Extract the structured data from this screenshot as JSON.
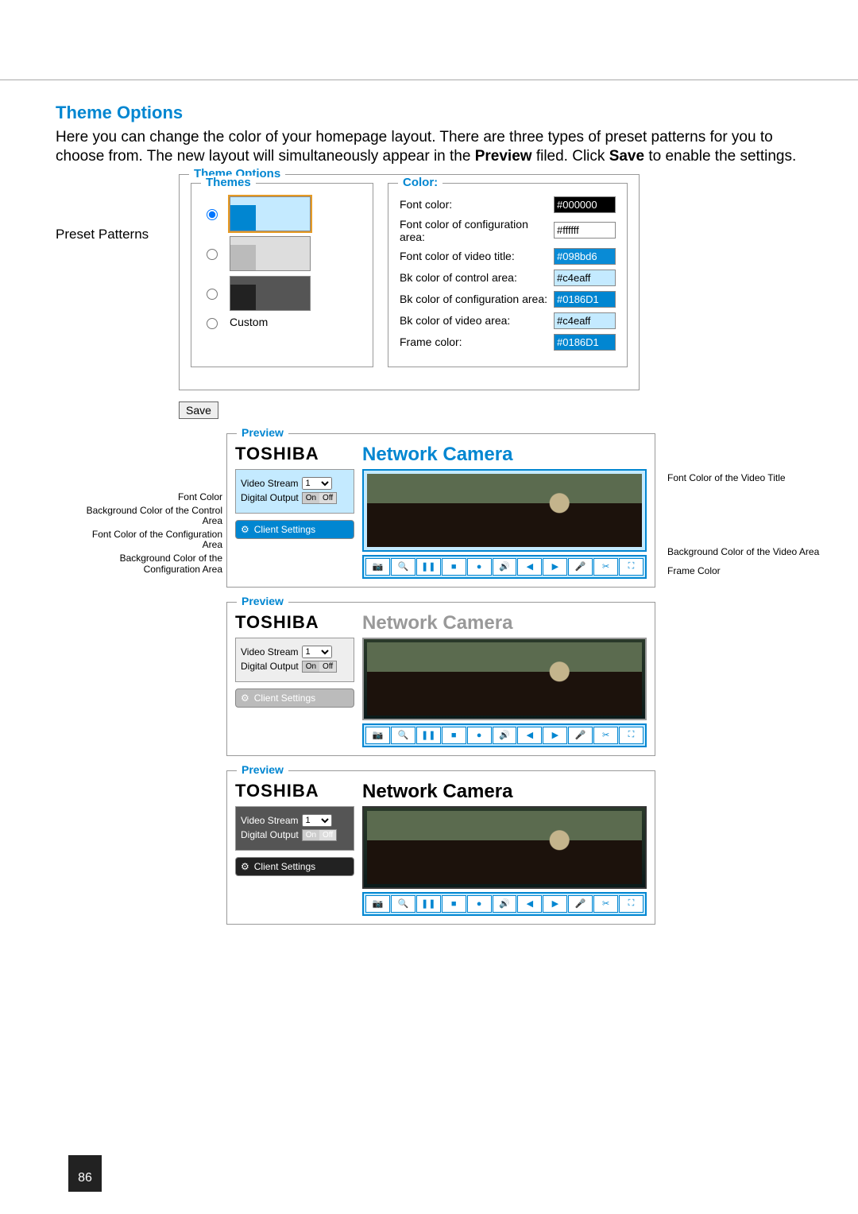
{
  "page_number": "86",
  "section_title": "Theme Options",
  "intro_html": "Here you can change the color of your homepage layout. There are three types of preset patterns for you to choose from. The new layout will simultaneously appear in the ",
  "intro_bold1": "Preview",
  "intro_mid": " filed. Click ",
  "intro_bold2": "Save",
  "intro_end": " to enable the settings.",
  "preset_patterns_label": "Preset Patterns",
  "theme_options_legend": "Theme Options",
  "themes_legend": "Themes",
  "color_legend": "Color:",
  "custom_label": "Custom",
  "colors": {
    "font_color_label": "Font color:",
    "font_color_value": "#000000",
    "font_cfg_label": "Font color of configuration area:",
    "font_cfg_value": "#ffffff",
    "font_video_label": "Font color of video title:",
    "font_video_value": "#098bd6",
    "bk_control_label": "Bk color of control area:",
    "bk_control_value": "#c4eaff",
    "bk_cfg_label": "Bk color of configuration area:",
    "bk_cfg_value": "#0186D1",
    "bk_video_label": "Bk color of video area:",
    "bk_video_value": "#c4eaff",
    "frame_label": "Frame color:",
    "frame_value": "#0186D1"
  },
  "save_label": "Save",
  "preview_legend": "Preview",
  "brand": "TOSHIBA",
  "cam_title": "Network Camera",
  "video_stream_label": "Video Stream",
  "video_stream_value": "1",
  "digital_output_label": "Digital Output",
  "on_label": "On",
  "off_label": "Off",
  "client_settings_label": "Client Settings",
  "callouts": {
    "font_color": "Font Color",
    "bg_control": "Background Color of the Control Area",
    "font_cfg": "Font Color of the Configuration Area",
    "bg_cfg": "Background Color of the Configuration Area",
    "font_video_title": "Font Color of the Video Title",
    "bg_video": "Background Color of the Video Area",
    "frame_color": "Frame Color"
  },
  "icons": [
    "●",
    "⊕",
    "❚❚",
    "■",
    "●",
    "▣",
    "◀",
    "▶",
    "⇧",
    "✂",
    "▢"
  ]
}
